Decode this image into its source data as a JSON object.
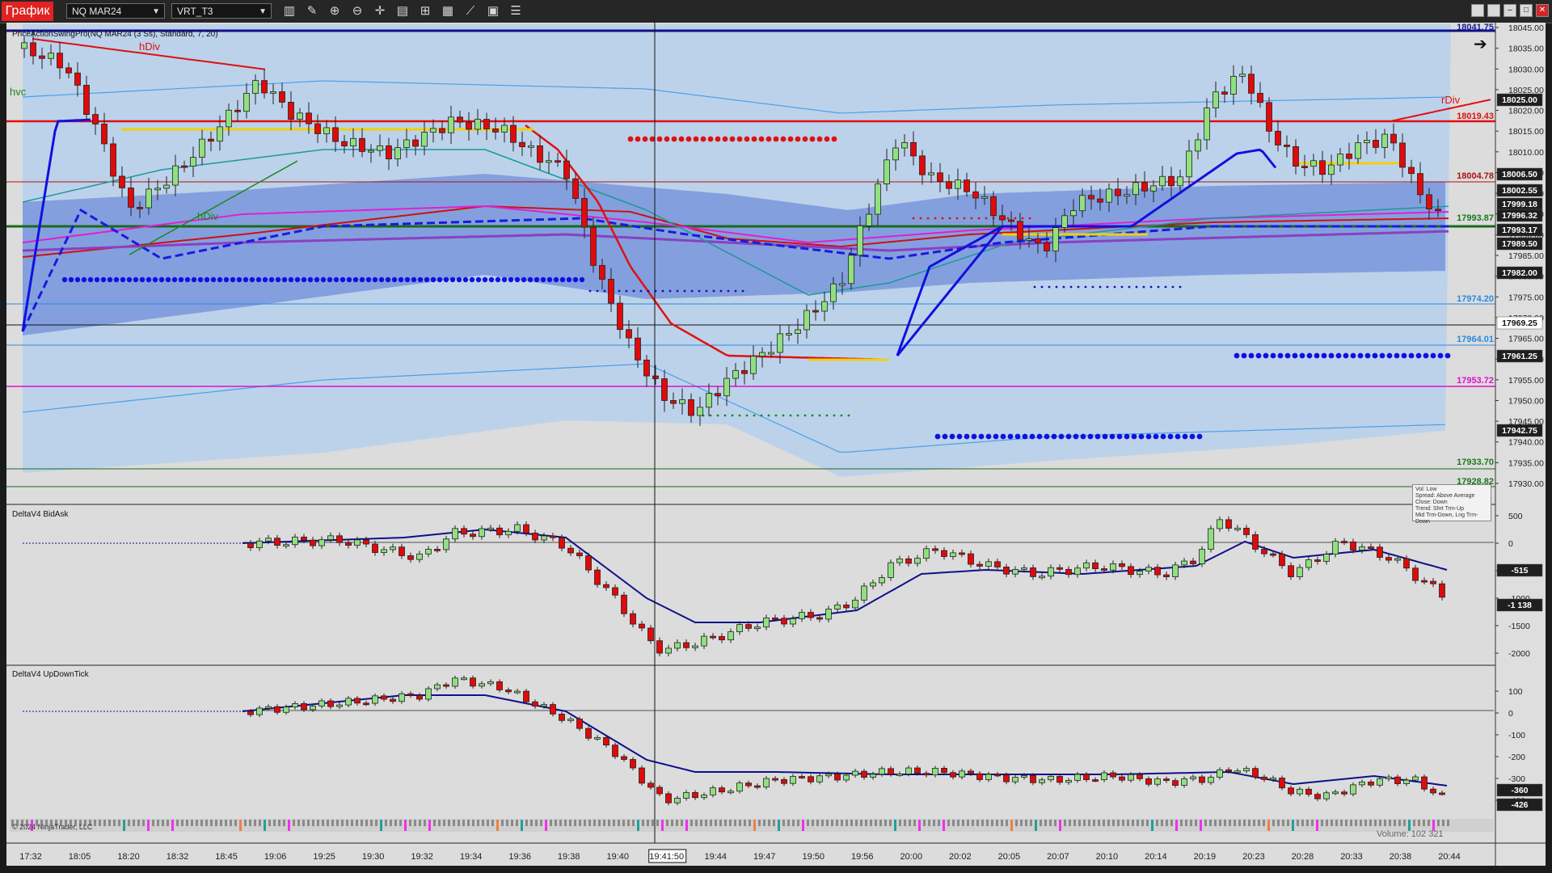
{
  "toolbar": {
    "tab_title": "График",
    "instrument": "NQ MAR24",
    "template": "VRT_T3",
    "icons": [
      "bar-type-icon",
      "draw-pencil-icon",
      "zoom-in-icon",
      "zoom-out-icon",
      "crosshair-icon",
      "properties-icon",
      "strategy-icon",
      "indicators-icon",
      "data-series-icon",
      "chart-trader-icon",
      "list-icon"
    ],
    "window_buttons": [
      "restore",
      "tile",
      "minimize",
      "maximize",
      "close"
    ]
  },
  "panels": {
    "price": {
      "label": "PriceActionSwingPro(NQ MAR24 (3 Ss), Standard, 7, 20)",
      "y_ticks": [
        "18045.00",
        "18035.00",
        "18030.00",
        "18025.00",
        "18020.00",
        "18015.00",
        "18010.00",
        "18005.00",
        "18000.00",
        "17995.00",
        "17990.00",
        "17985.00",
        "17980.00",
        "17975.00",
        "17970.00",
        "17965.00",
        "17960.00",
        "17955.00",
        "17950.00",
        "17945.00",
        "17940.00",
        "17935.00",
        "17930.00"
      ],
      "right_labels": [
        {
          "text": "18041.75",
          "color": "#1a1a9a",
          "style": "plain"
        },
        {
          "text": "18025.00",
          "color": "#ffffff",
          "bg": "#1f1f1f",
          "style": "box"
        },
        {
          "text": "18019.43",
          "color": "#e01010",
          "style": "plain"
        },
        {
          "text": "18006.50",
          "color": "#ffffff",
          "bg": "#1f1f1f",
          "style": "box"
        },
        {
          "text": "18004.78",
          "color": "#b01010",
          "style": "plain"
        },
        {
          "text": "18002.55",
          "color": "#ffffff",
          "bg": "#1f1f1f",
          "style": "box"
        },
        {
          "text": "17999.18",
          "color": "#ffffff",
          "bg": "#1f1f1f",
          "style": "box"
        },
        {
          "text": "17996.32",
          "color": "#ffffff",
          "bg": "#1f1f1f",
          "style": "box"
        },
        {
          "text": "17993.87",
          "color": "#1a7a1a",
          "style": "plain"
        },
        {
          "text": "17993.17",
          "color": "#ffffff",
          "bg": "#1f1f1f",
          "style": "box"
        },
        {
          "text": "17989.50",
          "color": "#ffffff",
          "bg": "#1f1f1f",
          "style": "box"
        },
        {
          "text": "17982.00",
          "color": "#ffffff",
          "bg": "#1f1f1f",
          "style": "box"
        },
        {
          "text": "17974.20",
          "color": "#2a8ae0",
          "style": "plain"
        },
        {
          "text": "17969.25",
          "color": "#111111",
          "bg": "#ffffff",
          "style": "box"
        },
        {
          "text": "17964.01",
          "color": "#2a8ae0",
          "style": "plain"
        },
        {
          "text": "17961.25",
          "color": "#ffffff",
          "bg": "#1f1f1f",
          "style": "box"
        },
        {
          "text": "17953.72",
          "color": "#e010d0",
          "style": "plain"
        },
        {
          "text": "17942.75",
          "color": "#ffffff",
          "bg": "#1f1f1f",
          "style": "box"
        },
        {
          "text": "17933.70",
          "color": "#1a7a1a",
          "style": "plain"
        },
        {
          "text": "17928.82",
          "color": "#1a7a1a",
          "style": "plain"
        }
      ],
      "annotations": [
        "hDiv",
        "hDiv",
        "rDiv",
        "hvc"
      ],
      "info_box": [
        "Vol: Low",
        "Spread: Above Average",
        "Close: Down",
        "Trend: Shrt Trm-Up",
        "Mid Trm-Down, Lng Trm-Down"
      ]
    },
    "bidask": {
      "label": "DeltaV4 BidAsk",
      "y_ticks": [
        "500",
        "0",
        "-500",
        "-1000",
        "-1500",
        "-2000"
      ],
      "right_labels": [
        {
          "text": "-515",
          "color": "#ffffff",
          "bg": "#1f1f1f",
          "style": "box"
        },
        {
          "text": "-1 138",
          "color": "#ffffff",
          "bg": "#1f1f1f",
          "style": "box"
        }
      ]
    },
    "updown": {
      "label": "DeltaV4 UpDownTick",
      "y_ticks": [
        "100",
        "0",
        "-100",
        "-200",
        "-300",
        "-400"
      ],
      "right_labels": [
        {
          "text": "-360",
          "color": "#ffffff",
          "bg": "#1f1f1f",
          "style": "box"
        },
        {
          "text": "-426",
          "color": "#ffffff",
          "bg": "#1f1f1f",
          "style": "box"
        }
      ],
      "copyright": "© 2024 NinjaTrader, LLC",
      "volume_text": "Volume: 102 321"
    }
  },
  "x_axis": {
    "labels": [
      "17:32",
      "18:05",
      "18:20",
      "18:32",
      "18:45",
      "19:06",
      "19:25",
      "19:30",
      "19:32",
      "19:34",
      "19:36",
      "19:38",
      "19:40",
      "19:41:50",
      "19:44",
      "19:47",
      "19:50",
      "19:56",
      "20:00",
      "20:02",
      "20:05",
      "20:07",
      "20:10",
      "20:14",
      "20:19",
      "20:23",
      "20:28",
      "20:33",
      "20:38",
      "20:44"
    ],
    "cursor_label": "19:41:50"
  },
  "colors": {
    "bull": "#90e080",
    "bear": "#e00a0a",
    "band_fill": "#6f8fda",
    "outer_band": "#bcd2ea",
    "background": "#dcdcdc"
  }
}
